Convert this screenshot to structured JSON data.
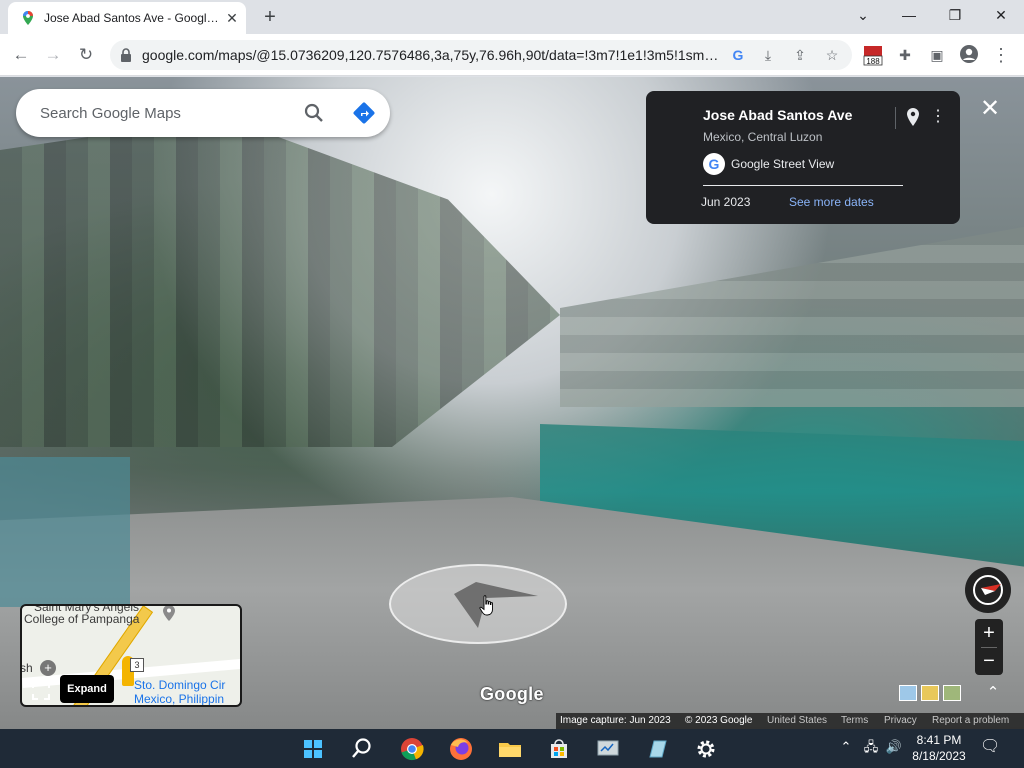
{
  "browser": {
    "tab_title": "Jose Abad Santos Ave - Google Maps",
    "url": "google.com/maps/@15.0736209,120.7576486,3a,75y,76.96h,90t/data=!3m7!1e1!3m5!1smS...",
    "extension_badge": "188",
    "icons": [
      "maps-favicon",
      "close-icon",
      "plus-icon",
      "chevron-down-icon",
      "minimize-icon",
      "restore-icon",
      "close-window-icon",
      "back-icon",
      "forward-icon",
      "reload-icon",
      "lock-icon",
      "google-icon",
      "install-icon",
      "share-icon",
      "star-icon",
      "extension-icon",
      "puzzle-icon",
      "sidepanel-icon",
      "profile-icon",
      "menu-icon"
    ]
  },
  "search": {
    "placeholder": "Search Google Maps"
  },
  "info_card": {
    "title": "Jose Abad Santos Ave",
    "subtitle": "Mexico, Central Luzon",
    "source": "Google Street View",
    "date": "Jun 2023",
    "more_dates": "See more dates"
  },
  "minimap": {
    "label_top": "Saint Mary's Angels",
    "label_school": "College of Pampanga",
    "label_sh": "sh",
    "route_number": "3",
    "label_church": "Sto. Domingo Cir",
    "label_place": "Mexico, Philippin",
    "expand_label": "Expand"
  },
  "map_logo": "Google",
  "zoom": {
    "in": "+",
    "out": "−"
  },
  "footer": {
    "capture": "Image capture: Jun 2023",
    "copyright": "© 2023 Google",
    "region": "United States",
    "terms": "Terms",
    "privacy": "Privacy",
    "report": "Report a problem"
  },
  "taskbar": {
    "apps": [
      "start",
      "search",
      "chrome",
      "firefox",
      "file-explorer",
      "store",
      "app-1",
      "app-2",
      "settings"
    ],
    "time": "8:41 PM",
    "date": "8/18/2023"
  },
  "colors": {
    "card_bg": "#202124",
    "link_blue": "#8ab4f8",
    "taskbar_bg": "#1f2a37"
  }
}
